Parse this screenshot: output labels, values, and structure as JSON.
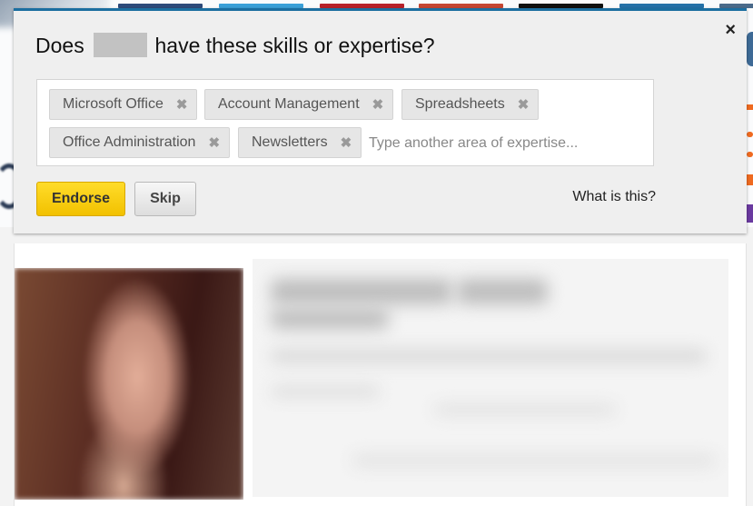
{
  "modal": {
    "title_prefix": "Does",
    "title_suffix": "have these skills or expertise?",
    "close_icon": "×",
    "skills": [
      {
        "label": "Microsoft Office"
      },
      {
        "label": "Account Management"
      },
      {
        "label": "Spreadsheets"
      },
      {
        "label": "Office Administration"
      },
      {
        "label": "Newsletters"
      }
    ],
    "remove_icon": "✖",
    "input_placeholder": "Type another area of expertise...",
    "input_value": "",
    "endorse_label": "Endorse",
    "skip_label": "Skip",
    "help_link": "What is this?"
  },
  "colors": {
    "modal_accent": "#1b6ea0",
    "endorse_button": "#f5c800",
    "social_strips": [
      "#2d4a7a",
      "#3aa0d8",
      "#b8222a",
      "#c54632",
      "#101010",
      "#2471a8",
      "#4a6a8a"
    ]
  }
}
